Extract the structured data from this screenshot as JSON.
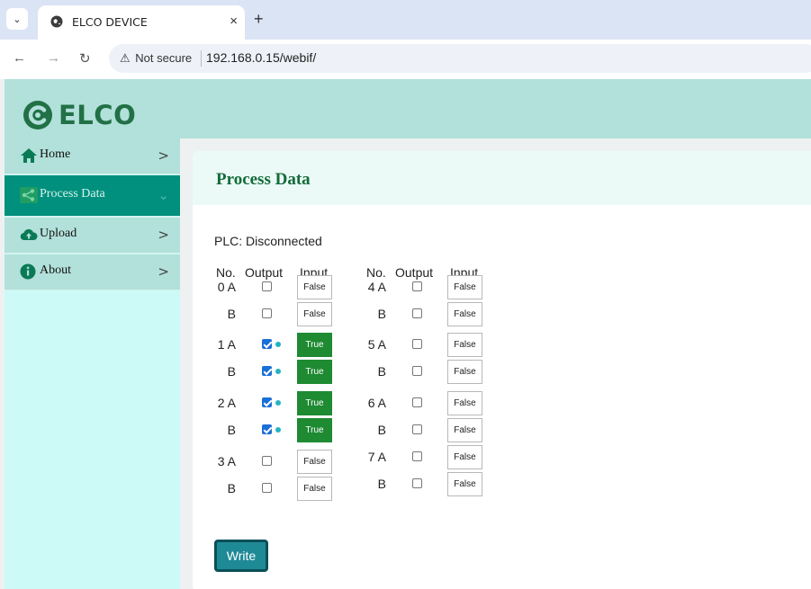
{
  "browser": {
    "tab_title": "ELCO DEVICE",
    "close_glyph": "×",
    "new_tab_glyph": "+",
    "security_label": "Not secure",
    "url": "192.168.0.15/webif/"
  },
  "header": {
    "logo_text": "ELCO"
  },
  "sidebar": {
    "items": [
      {
        "label": "Home",
        "icon": "home-icon",
        "active": false
      },
      {
        "label": "Process Data",
        "icon": "share-icon",
        "active": true
      },
      {
        "label": "Upload",
        "icon": "cloud-upload-icon",
        "active": false
      },
      {
        "label": "About",
        "icon": "info-icon",
        "active": false
      }
    ]
  },
  "main": {
    "title": "Process Data",
    "plc_label": "PLC:",
    "plc_status": "Disconnected",
    "headers": {
      "no": "No.",
      "output": "Output",
      "input": "Input"
    },
    "left_rows": [
      {
        "no": "0 A",
        "output": false,
        "input": "False"
      },
      {
        "no": "B",
        "output": false,
        "input": "False"
      },
      {
        "no": "1 A",
        "output": true,
        "input": "True"
      },
      {
        "no": "B",
        "output": true,
        "input": "True"
      },
      {
        "no": "2 A",
        "output": true,
        "input": "True"
      },
      {
        "no": "B",
        "output": true,
        "input": "True"
      },
      {
        "no": "3 A",
        "output": false,
        "input": "False"
      },
      {
        "no": "B",
        "output": false,
        "input": "False"
      }
    ],
    "right_rows": [
      {
        "no": "4 A",
        "output": false,
        "input": "False"
      },
      {
        "no": "B",
        "output": false,
        "input": "False"
      },
      {
        "no": "5 A",
        "output": false,
        "input": "False"
      },
      {
        "no": "B",
        "output": false,
        "input": "False"
      },
      {
        "no": "6 A",
        "output": false,
        "input": "False"
      },
      {
        "no": "B",
        "output": false,
        "input": "False"
      },
      {
        "no": "7 A",
        "output": false,
        "input": "False"
      },
      {
        "no": "B",
        "output": false,
        "input": "False"
      }
    ],
    "write_label": "Write"
  },
  "colors": {
    "accent": "#00907d",
    "header_bg": "#b2e0da",
    "sidebar_bg": "#ccfaf6",
    "true_green": "#1e8a32",
    "button": "#1e8a96"
  }
}
